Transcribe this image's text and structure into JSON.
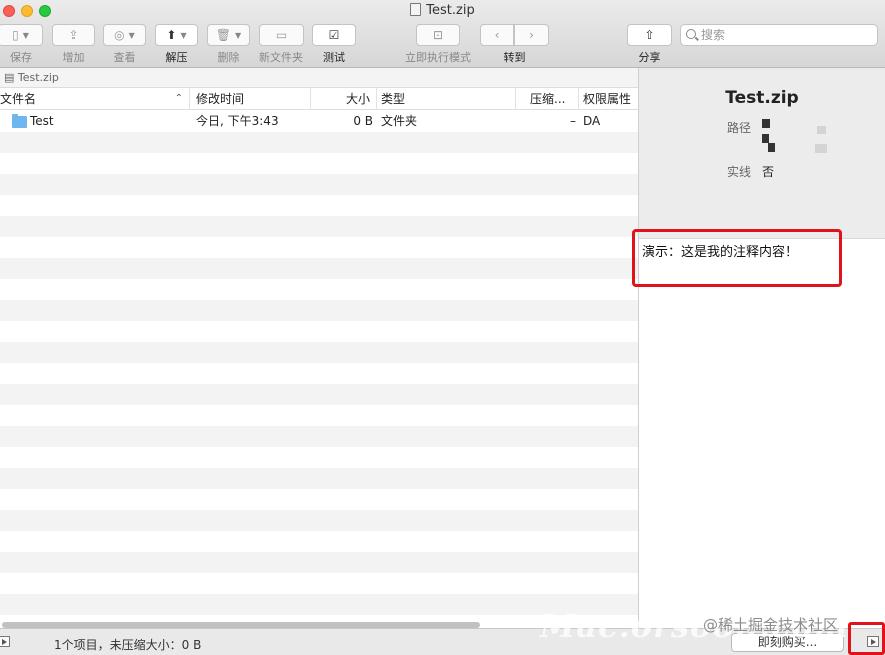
{
  "window": {
    "title": "Test.zip"
  },
  "toolbar": {
    "save": "保存",
    "add": "增加",
    "view": "查看",
    "extract": "解压",
    "delete": "删除",
    "new_folder": "新文件夹",
    "test": "测试",
    "run_mode": "立即执行模式",
    "goto": "转到",
    "share": "分享",
    "search_placeholder": "搜索"
  },
  "pathbar": {
    "label": "Test.zip"
  },
  "table": {
    "headers": [
      "文件名",
      "修改时间",
      "大小",
      "类型",
      "压缩...",
      "权限属性"
    ],
    "rows": [
      {
        "name": "Test",
        "modified": "今日, 下午3:43",
        "size": "0 B",
        "kind": "文件夹",
        "compressed": "–",
        "perm": "DA"
      }
    ]
  },
  "info": {
    "title": "Test.zip",
    "path_label": "路径",
    "alias_label": "实线",
    "alias_value": "否"
  },
  "comment": "演示：这是我的注释内容！",
  "status": {
    "text": "1个项目，未压缩大小：0 B",
    "buy_label": "即刻购买..."
  },
  "watermark": {
    "main": "Mac.orsoon.com",
    "secondary": "@稀土掘金技术社区"
  },
  "colors": {
    "highlight": "#e0131b",
    "folder": "#6db6ef"
  }
}
